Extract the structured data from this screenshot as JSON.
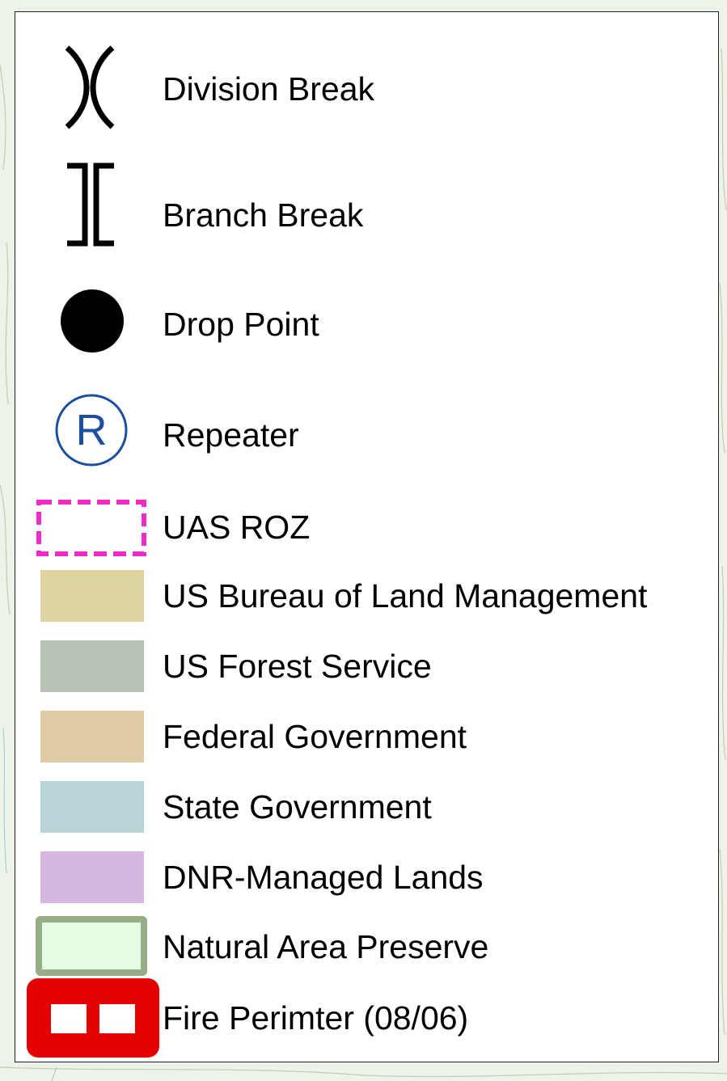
{
  "legend": {
    "items": [
      {
        "label": "Division Break",
        "symbol": "division-break-icon"
      },
      {
        "label": "Branch Break",
        "symbol": "branch-break-icon"
      },
      {
        "label": "Drop Point",
        "symbol": "filled-circle-icon"
      },
      {
        "label": "Repeater",
        "symbol": "circled-r-icon",
        "glyph": "R"
      },
      {
        "label": "UAS ROZ",
        "symbol": "dashed-rectangle-icon"
      },
      {
        "label": "US Bureau of Land Management",
        "symbol": "swatch",
        "color": "#ded3a1"
      },
      {
        "label": "US Forest Service",
        "symbol": "swatch",
        "color": "#b7c3b4"
      },
      {
        "label": "Federal Government",
        "symbol": "swatch",
        "color": "#dfcba4"
      },
      {
        "label": "State Government",
        "symbol": "swatch",
        "color": "#b9d4d8"
      },
      {
        "label": "DNR-Managed Lands",
        "symbol": "swatch",
        "color": "#d6b7e2"
      },
      {
        "label": "Natural Area Preserve",
        "symbol": "outlined-swatch",
        "color": "#e6fbe3",
        "outline_color": "#97ad86"
      },
      {
        "label": "Fire Perimter (08/06)",
        "symbol": "fire-perimeter-icon",
        "color": "#e30000"
      }
    ]
  },
  "colors": {
    "repeater": "#1d4fa0",
    "uas_roz": "#f02ac9",
    "map_background": "#eef3ea",
    "contour": "#b9cfa9"
  }
}
